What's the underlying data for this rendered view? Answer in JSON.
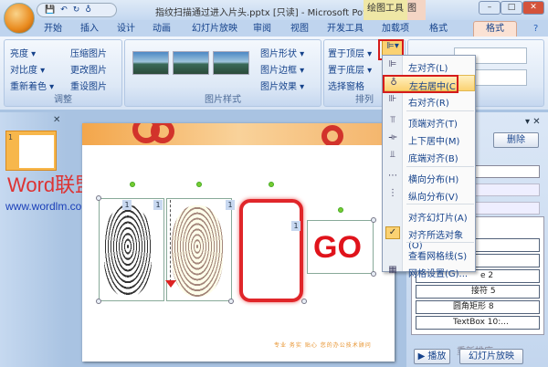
{
  "window": {
    "title": "指纹扫描通过进入片头.pptx [只读] - Microsoft PowerPoint",
    "context_tools": "绘图工具",
    "context_tools2": "图",
    "min": "–",
    "max": "□",
    "close": "✕"
  },
  "qat": {
    "save": "💾",
    "undo": "↶",
    "redo": "↻",
    "extra": "♁"
  },
  "tabs": [
    "开始",
    "插入",
    "设计",
    "动画",
    "幻灯片放映",
    "审阅",
    "视图",
    "开发工具",
    "加载项",
    "格式",
    "格式"
  ],
  "ribbon": {
    "adjust": {
      "label": "调整",
      "items": [
        "亮度 ▾",
        "对比度 ▾",
        "重新着色 ▾",
        "压缩图片",
        "更改图片",
        "重设图片"
      ]
    },
    "picture_styles": {
      "label": "图片样式",
      "items": [
        "图片形状 ▾",
        "图片边框 ▾",
        "图片效果 ▾"
      ]
    },
    "arrange": {
      "label": "排列",
      "items": [
        "置于顶层 ▾",
        "置于底层 ▾",
        "选择窗格"
      ]
    }
  },
  "align_menu": {
    "items": [
      {
        "label": "左对齐(L)",
        "icon": "⊫"
      },
      {
        "label": "左右居中(C)",
        "icon": "♁",
        "highlighted": true
      },
      {
        "label": "右对齐(R)",
        "icon": "⊪"
      },
      {
        "label": "顶端对齐(T)",
        "icon": "⫪"
      },
      {
        "label": "上下居中(M)",
        "icon": "⟛"
      },
      {
        "label": "底端对齐(B)",
        "icon": "⫫"
      },
      {
        "label": "横向分布(H)",
        "icon": "⋯"
      },
      {
        "label": "纵向分布(V)",
        "icon": "⋮"
      },
      {
        "label": "对齐幻灯片(A)",
        "icon": ""
      },
      {
        "label": "对齐所选对象(O)",
        "icon": "✓",
        "checked": true
      },
      {
        "label": "查看网格线(S)",
        "icon": ""
      },
      {
        "label": "网格设置(G)...",
        "icon": "▦"
      }
    ]
  },
  "left_pane": {
    "slide_number": "1",
    "close": "✕",
    "watermark": "Word联盟",
    "watermark_url": "www.wordlm.com"
  },
  "slide": {
    "go_text": "GO",
    "badges": [
      "1",
      "1",
      "1",
      "1"
    ],
    "footer": "专业 务实 贴心 您的办公技术顾问"
  },
  "task_pane": {
    "delete": "删除",
    "list": [
      "接符 5",
      "接符 5",
      "e 2",
      "接符 5",
      "圆角矩形 8",
      "TextBox 10:..."
    ],
    "reorder": "重新排序",
    "play": "▶ 播放",
    "slideshow": "幻灯片放映"
  }
}
